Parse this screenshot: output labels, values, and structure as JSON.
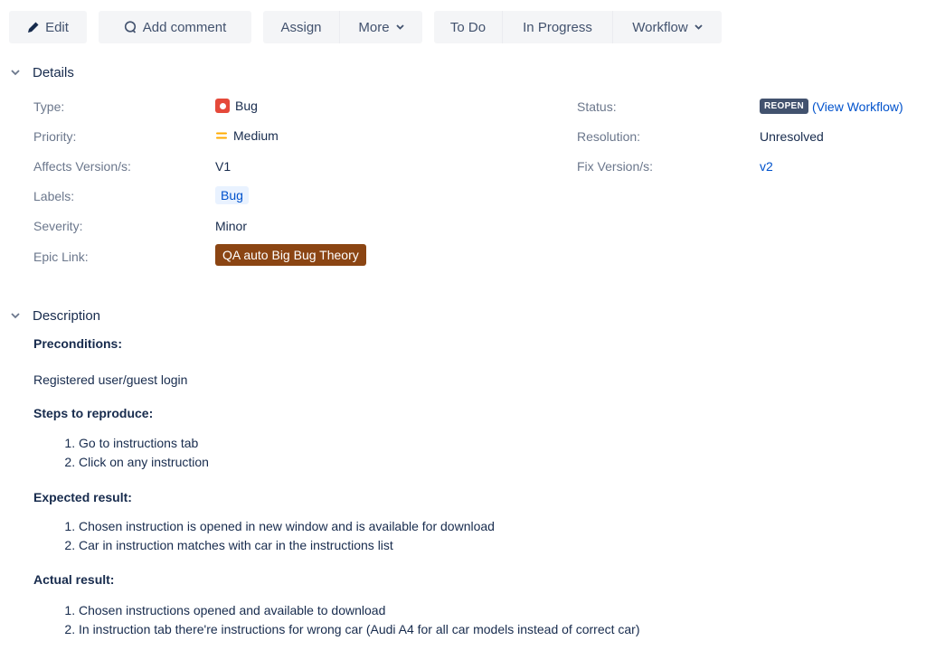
{
  "toolbar": {
    "edit": "Edit",
    "add_comment": "Add comment",
    "assign": "Assign",
    "more": "More",
    "to_do": "To Do",
    "in_progress": "In Progress",
    "workflow": "Workflow"
  },
  "details": {
    "heading": "Details",
    "left": [
      {
        "label": "Type:",
        "value": "Bug"
      },
      {
        "label": "Priority:",
        "value": "Medium"
      },
      {
        "label": "Affects Version/s:",
        "value": "V1"
      },
      {
        "label": "Labels:",
        "value": "Bug"
      },
      {
        "label": "Severity:",
        "value": "Minor"
      },
      {
        "label": "Epic Link:",
        "value": "QA auto Big Bug Theory"
      }
    ],
    "right": [
      {
        "label": "Status:",
        "value": "REOPEN",
        "link": "(View Workflow)"
      },
      {
        "label": "Resolution:",
        "value": "Unresolved"
      },
      {
        "label": "Fix Version/s:",
        "value": "v2"
      }
    ]
  },
  "description": {
    "heading": "Description",
    "preconditions_title": "Preconditions:",
    "preconditions_text": "Registered user/guest login",
    "steps_title": "Steps to reproduce:",
    "steps": [
      "Go to instructions tab",
      "Click on any instruction"
    ],
    "expected_title": "Expected result:",
    "expected": [
      "Chosen instruction is opened in new window and is available for download",
      "Car in instruction matches with car in the instructions list"
    ],
    "actual_title": "Actual result:",
    "actual": [
      "Chosen instructions opened and available to download",
      "In instruction tab there're instructions for wrong car (Audi A4 for all car models instead of correct car)"
    ]
  },
  "colors": {
    "epic": "#8b4513",
    "bug_icon": "#e5493a",
    "priority": "#ffab00",
    "link": "#0052cc",
    "status_lozenge": "#42526e"
  },
  "icons": [
    "pencil-icon",
    "comment-icon",
    "chevron-down-icon",
    "bug-type-icon",
    "medium-priority-icon"
  ]
}
